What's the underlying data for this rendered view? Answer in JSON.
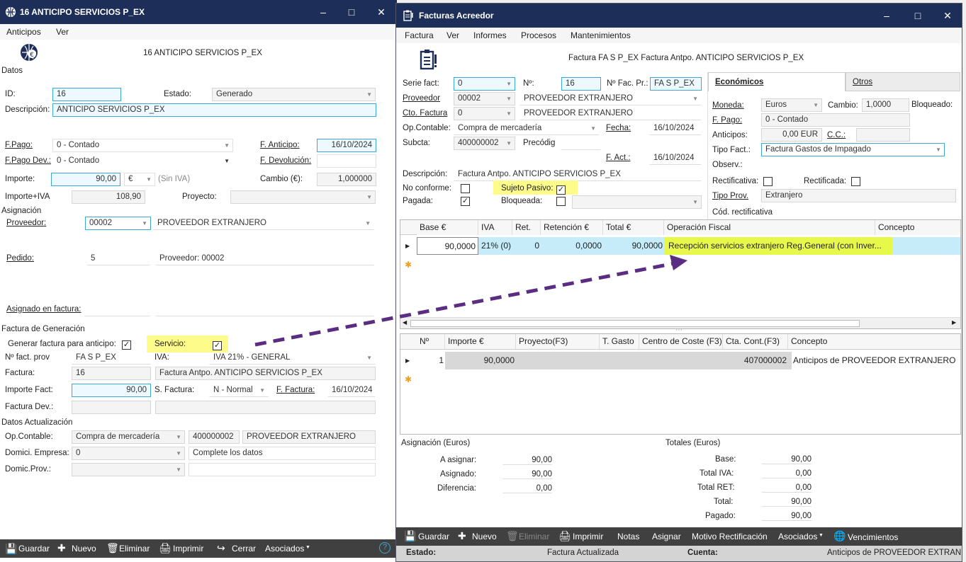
{
  "left_window": {
    "title": "16 ANTICIPO SERVICIOS P_EX",
    "menu": [
      "Anticipos",
      "Ver"
    ],
    "header_title": "16 ANTICIPO SERVICIOS P_EX",
    "section_datos": "Datos",
    "id_label": "ID:",
    "id_value": "16",
    "estado_label": "Estado:",
    "estado_value": "Generado",
    "descripcion_label": "Descripción:",
    "descripcion_value": "ANTICIPO SERVICIOS P_EX",
    "fpago_label": "F.Pago:",
    "fpago_value": "0 - Contado",
    "fanticipo_label": "F. Anticipo:",
    "fanticipo_value": "16/10/2024",
    "fpagodev_label": "F.Pago Dev.:",
    "fpagodev_value": "0 - Contado",
    "fdevolucion_label": "F. Devolución:",
    "importe_label": "Importe:",
    "importe_value": "90,00",
    "currency_value": "€",
    "sin_iva": "(Sin IVA)",
    "cambio_label": "Cambio (€):",
    "cambio_value": "1,000000",
    "importe_iva_label": "Importe+IVA",
    "importe_iva_value": "108,90",
    "proyecto_label": "Proyecto:",
    "section_asignacion": "Asignación",
    "proveedor_label": "Proveedor:",
    "proveedor_code": "00002",
    "proveedor_name": "PROVEEDOR EXTRANJERO",
    "pedido_label": "Pedido:",
    "pedido_value": "5",
    "pedido_proveedor": "Proveedor: 00002",
    "asignado_label": "Asignado en factura:",
    "section_factura_gen": "Factura de Generación",
    "generar_label": "Generar factura para anticipo:",
    "servicio_label": "Servicio:",
    "nfact_prov_label": "Nº fact. prov",
    "nfact_prov_value": "FA S P_EX",
    "iva_label": "IVA:",
    "iva_value": "IVA 21% - GENERAL",
    "factura_label": "Factura:",
    "factura_value": "16",
    "factura_desc": "Factura Antpo. ANTICIPO SERVICIOS P_EX",
    "importe_fact_label": "Importe Fact:",
    "importe_fact_value": "90,00",
    "sfactura_label": "S. Factura:",
    "sfactura_value": "N - Normal",
    "ffactura_label": "F. Factura:",
    "ffactura_value": "16/10/2024",
    "factura_dev_label": "Factura Dev.:",
    "section_datos_act": "Datos Actualización",
    "opcontable_label": "Op.Contable:",
    "opcontable_value": "Compra de mercadería",
    "opcontable_account": "400000002",
    "opcontable_name": "PROVEEDOR EXTRANJERO",
    "domici_empresa_label": "Domici. Empresa:",
    "domici_empresa_value": "0",
    "domici_empresa_note": "Complete los datos",
    "domic_prov_label": "Domic.Prov.:",
    "toolbar": {
      "guardar": "Guardar",
      "nuevo": "Nuevo",
      "eliminar": "Eliminar",
      "imprimir": "Imprimir",
      "cerrar": "Cerrar",
      "asociados": "Asociados"
    }
  },
  "right_window": {
    "title": "Facturas Acreedor",
    "menu": [
      "Factura",
      "Ver",
      "Informes",
      "Procesos",
      "Mantenimientos"
    ],
    "header_title": "Factura FA S P_EX Factura Antpo. ANTICIPO SERVICIOS P_EX",
    "serie_label": "Serie fact:",
    "serie_value": "0",
    "n_label": "Nº:",
    "n_value": "16",
    "nfacpr_label": "Nº Fac. Pr.:",
    "nfacpr_value": "FA S P_EX",
    "proveedor_label": "Proveedor",
    "proveedor_code": "00002",
    "proveedor_name": "PROVEEDOR EXTRANJERO",
    "cto_factura_label": "Cto. Factura",
    "cto_factura_value": "0",
    "cto_factura_name": "PROVEEDOR EXTRANJERO",
    "opcontable_label": "Op.Contable:",
    "opcontable_value": "Compra de mercadería",
    "fecha_label": "Fecha:",
    "fecha_value": "16/10/2024",
    "subcta_label": "Subcta:",
    "subcta_value": "400000002",
    "precodig_label": "Precódig",
    "fact_label": "F. Act.:",
    "fact_value": "16/10/2024",
    "descripcion_label": "Descripción:",
    "descripcion_value": "Factura Antpo. ANTICIPO SERVICIOS P_EX",
    "no_conforme_label": "No conforme:",
    "sujeto_pasivo_label": "Sujeto Pasivo:",
    "pagada_label": "Pagada:",
    "bloqueada_label": "Bloqueada:",
    "tabs": [
      "Económicos",
      "Otros"
    ],
    "moneda_label": "Moneda:",
    "moneda_value": "Euros",
    "cambio_label": "Cambio:",
    "cambio_value": "1,0000",
    "bloqueado_label": "Bloqueado:",
    "fpago_label": "F. Pago:",
    "fpago_value": "0 - Contado",
    "anticipos_label": "Anticipos:",
    "anticipos_value": "0,00 EUR",
    "cc_label": "C.C.:",
    "tipo_fact_label": "Tipo Fact.:",
    "tipo_fact_value": "Factura Gastos de Impagado",
    "observ_label": "Observ.:",
    "rectificativa_label": "Rectificativa:",
    "rectificada_label": "Rectificada:",
    "tipo_prov_label": "Tipo Prov.",
    "tipo_prov_value": "Extranjero",
    "cod_rect_label": "Cód. rectificativa",
    "iva_grid": {
      "headers": [
        "Base €",
        "IVA",
        "Ret.",
        "Retención €",
        "Total €",
        "Operación Fiscal",
        "Concepto"
      ],
      "row": [
        "90,0000",
        "21% (0)",
        "0",
        "0,0000",
        "90,0000",
        "Recepción servicios extranjero Reg.General (con Inver..."
      ]
    },
    "lines_grid": {
      "headers": [
        "Nº",
        "Importe €",
        "Proyecto(F3)",
        "T. Gasto",
        "Centro de Coste (F3)",
        "Cta. Cont.(F3)",
        "Concepto"
      ],
      "row": [
        "1",
        "90,0000",
        "",
        "",
        "",
        "407000002",
        "Anticipos de PROVEEDOR EXTRANJERO"
      ]
    },
    "asignacion_title": "Asignación (Euros)",
    "a_asignar_label": "A asignar:",
    "a_asignar_value": "90,00",
    "asignado_label": "Asignado:",
    "asignado_value": "90,00",
    "diferencia_label": "Diferencia:",
    "diferencia_value": "0,00",
    "totales_title": "Totales (Euros)",
    "base_label": "Base:",
    "base_value": "90,00",
    "total_iva_label": "Total IVA:",
    "total_iva_value": "0,00",
    "total_ret_label": "Total RET:",
    "total_ret_value": "0,00",
    "total_label": "Total:",
    "total_value": "90,00",
    "pagado_label": "Pagado:",
    "pagado_value": "90,00",
    "toolbar": {
      "guardar": "Guardar",
      "nuevo": "Nuevo",
      "eliminar": "Eliminar",
      "imprimir": "Imprimir",
      "notas": "Notas",
      "asignar": "Asignar",
      "motivo": "Motivo Rectificación",
      "asociados": "Asociados",
      "vencimientos": "Vencimientos"
    },
    "status": {
      "estado_label": "Estado:",
      "estado_value": "Factura Actualizada",
      "cuenta_label": "Cuenta:",
      "cuenta_value": "Anticipos de PROVEEDOR EXTRAN"
    }
  },
  "colors": {
    "titlebar": "#1d2f59",
    "highlight": "#fdfb8a",
    "selected_row": "#c6ecf9",
    "edit_border": "#3fa7d6",
    "arrow": "#5a2d82",
    "toolbar": "#404040"
  }
}
